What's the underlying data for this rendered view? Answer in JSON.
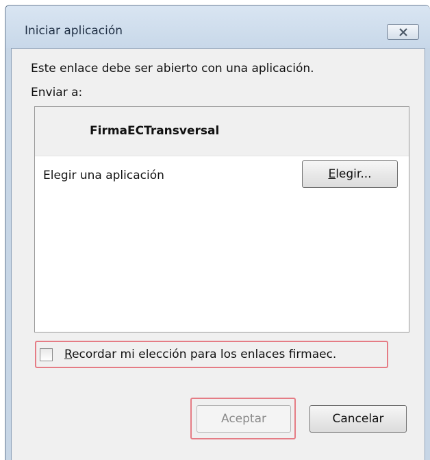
{
  "window": {
    "title": "Iniciar aplicación"
  },
  "dialog": {
    "description": "Este enlace debe ser abierto con una aplicación.",
    "send_to_label": "Enviar a:",
    "app_name": "FirmaECTransversal",
    "choose_app_label": "Elegir una aplicación",
    "choose_button": {
      "mnemonic": "E",
      "rest": "legir..."
    },
    "remember": {
      "checked": false,
      "mnemonic": "R",
      "rest": "ecordar mi elección para los enlaces firmaec."
    },
    "accept_button": "Aceptar",
    "cancel_button": "Cancelar"
  },
  "colors": {
    "highlight_outline": "#e57c85",
    "title_bar": "#c8d8e9",
    "client_bg": "#f0f0f0"
  },
  "icons": {
    "close": "close-icon"
  }
}
